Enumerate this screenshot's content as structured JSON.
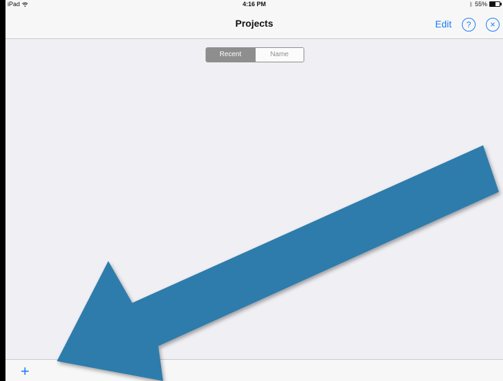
{
  "status_bar": {
    "device": "iPad",
    "time": "4:16 PM",
    "battery": "55%",
    "battery_level": 0.55
  },
  "nav": {
    "title": "Projects",
    "edit_label": "Edit",
    "help_icon": "?",
    "close_icon": "×"
  },
  "segment": {
    "recent_label": "Recent",
    "name_label": "Name",
    "selected": "Recent"
  },
  "toolbar": {
    "add_icon": "+"
  },
  "annotation": {
    "color": "#2d7bab",
    "icon": "arrow-annotation"
  }
}
